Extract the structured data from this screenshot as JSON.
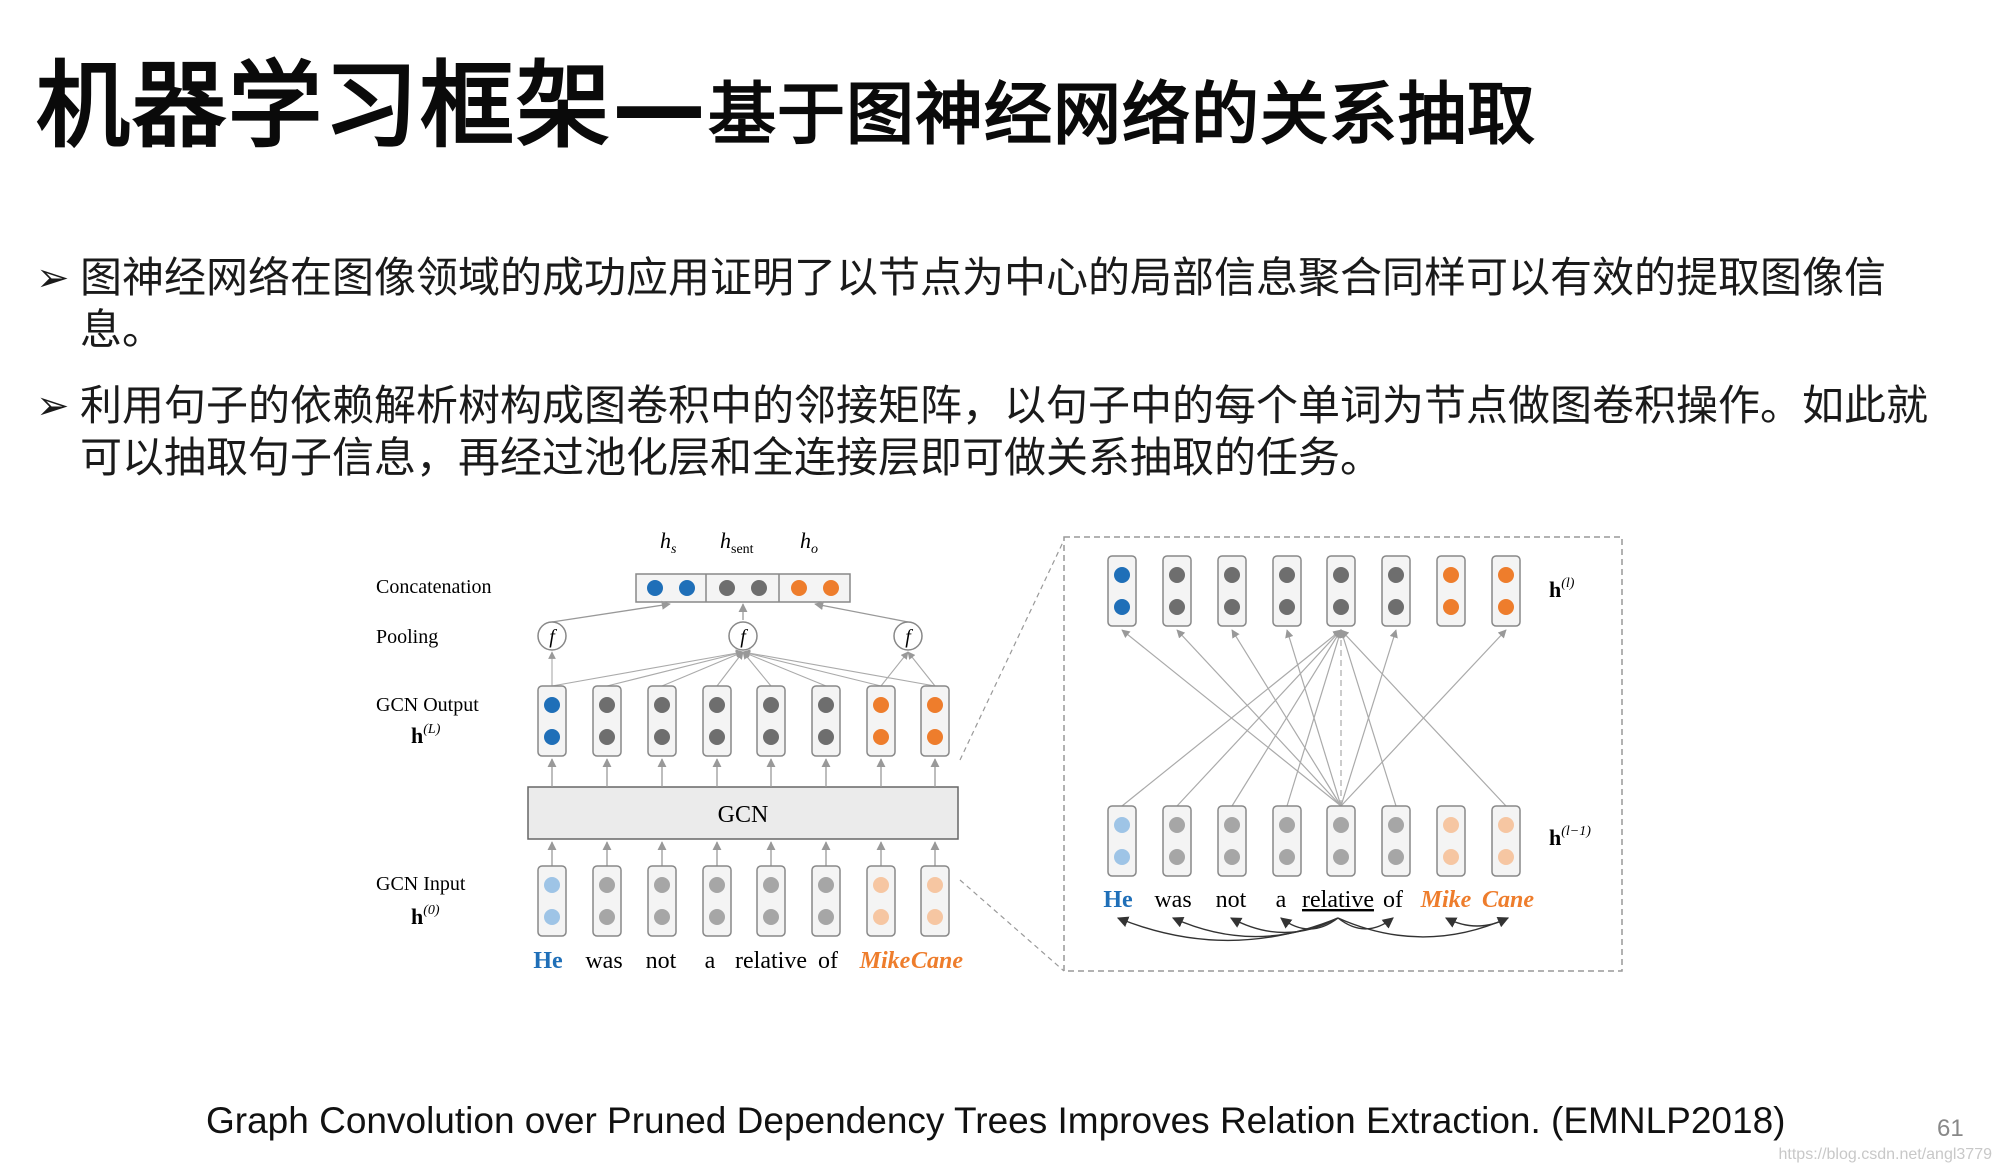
{
  "slide": {
    "title_main": "机器学习框架—",
    "title_sub": "基于图神经网络的关系抽取",
    "bullet_marker": "➢",
    "bullets": [
      "图神经网络在图像领域的成功应用证明了以节点为中心的局部信息聚合同样可以有效的提取图像信息。",
      "利用句子的依赖解析树构成图卷积中的邻接矩阵，以句子中的每个单词为节点做图卷积操作。如此就可以抽取句子信息，再经过池化层和全连接层即可做关系抽取的任务。"
    ],
    "reference": "Graph Convolution over Pruned Dependency Trees Improves Relation Extraction. (EMNLP2018)",
    "page_number": "61",
    "watermark": "https://blog.csdn.net/angl3779"
  },
  "diagram": {
    "left": {
      "row_labels": {
        "concatenation": "Concatenation",
        "pooling": "Pooling",
        "gcn_output": "GCN Output",
        "gcn_input": "GCN Input"
      },
      "output_math": [
        "h",
        "(L)"
      ],
      "input_math": [
        "h",
        "(0)"
      ],
      "top_labels": [
        [
          "h",
          "s"
        ],
        [
          "h",
          "sent"
        ],
        [
          "h",
          "o"
        ]
      ],
      "pool_symbol": "f",
      "gcn_label": "GCN",
      "words": [
        "He",
        "was",
        "not",
        "a",
        "relative",
        "of",
        "Mike",
        "Cane"
      ],
      "word_roles": [
        "subject",
        "none",
        "none",
        "none",
        "none",
        "none",
        "object",
        "object"
      ]
    },
    "right": {
      "top_math": [
        "h",
        "(l)"
      ],
      "bottom_math": [
        "h",
        "(l−1)"
      ],
      "words": [
        "He",
        "was",
        "not",
        "a",
        "relative",
        "of",
        "Mike",
        "Cane"
      ],
      "word_roles": [
        "subject",
        "none",
        "none",
        "none",
        "none",
        "none",
        "object",
        "object"
      ],
      "head_word": "relative"
    },
    "colors": {
      "subject": "#1f6fb8",
      "subject_light": "#9ec4e6",
      "object": "#ee7d2c",
      "object_light": "#f6c6a2",
      "neutral": "#6e6e6e",
      "neutral_light": "#a6a6a6"
    }
  }
}
